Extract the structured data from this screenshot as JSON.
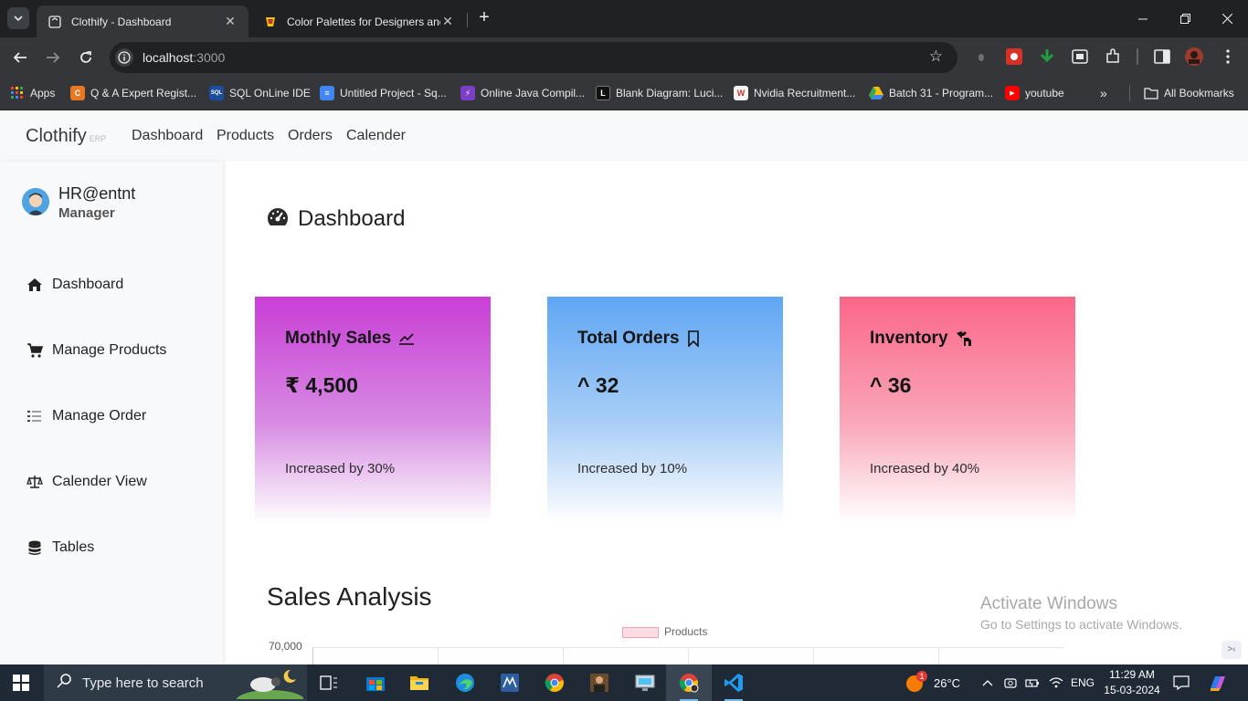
{
  "browser": {
    "tabs": [
      {
        "title": "Clothify - Dashboard",
        "active": true
      },
      {
        "title": "Color Palettes for Designers and",
        "active": false
      }
    ],
    "url_host": "localhost",
    "url_port": ":3000",
    "bookmarks": [
      {
        "label": "Apps",
        "icon": "apps-grid-icon"
      },
      {
        "label": "Q & A Expert Regist...",
        "icon": "chegg-icon",
        "color": "#e87722"
      },
      {
        "label": "SQL OnLine IDE",
        "icon": "sql-icon",
        "color": "#1b4d9c"
      },
      {
        "label": "Untitled Project - Sq...",
        "icon": "docs-icon",
        "color": "#4285f4"
      },
      {
        "label": "Online Java Compil...",
        "icon": "bolt-icon",
        "color": "#7b3fc7"
      },
      {
        "label": "Blank Diagram: Luci...",
        "icon": "lucid-icon",
        "color": "#111111"
      },
      {
        "label": "Nvidia Recruitment...",
        "icon": "workday-icon",
        "color": "#f5f5f5"
      },
      {
        "label": "Batch 31 - Program...",
        "icon": "drive-icon",
        "color": "#34a853"
      },
      {
        "label": "youtube",
        "icon": "youtube-icon",
        "color": "#ff0000"
      }
    ],
    "all_bookmarks": "All Bookmarks"
  },
  "app": {
    "brand": "Clothify",
    "brand_sub": "ERP",
    "nav": [
      "Dashboard",
      "Products",
      "Orders",
      "Calender"
    ],
    "user": {
      "name": "HR@entnt",
      "role": "Manager"
    },
    "sidebar": [
      {
        "label": "Dashboard",
        "icon": "home-icon"
      },
      {
        "label": "Manage Products",
        "icon": "cart-icon"
      },
      {
        "label": "Manage Order",
        "icon": "list-icon"
      },
      {
        "label": "Calender View",
        "icon": "scale-icon"
      },
      {
        "label": "Tables",
        "icon": "database-icon"
      }
    ],
    "page_title": "Dashboard",
    "cards": [
      {
        "title": "Mothly Sales",
        "value": "₹ 4,500",
        "sub": "Increased by 30%",
        "icon": "chart-line-icon"
      },
      {
        "title": "Total Orders",
        "value": "^ 32",
        "sub": "Increased by 10%",
        "icon": "bookmark-icon"
      },
      {
        "title": "Inventory",
        "value": "^ 36",
        "sub": "Increased by 40%",
        "icon": "shirt-hanger-icon"
      }
    ],
    "section_title": "Sales Analysis"
  },
  "chart_data": {
    "type": "bar",
    "legend": [
      "Products"
    ],
    "series": [
      {
        "name": "Products",
        "values": []
      }
    ],
    "y_ticks_visible": [
      "70,000"
    ],
    "colors": {
      "fill": "#fbdce2",
      "border": "#f4a0b0"
    }
  },
  "windows": {
    "activate_title": "Activate Windows",
    "activate_sub": "Go to Settings to activate Windows.",
    "taskbar_search": "Type here to search",
    "weather": "26°C",
    "weather_badge": "1",
    "lang": "ENG",
    "time": "11:29 AM",
    "date": "15-03-2024"
  }
}
